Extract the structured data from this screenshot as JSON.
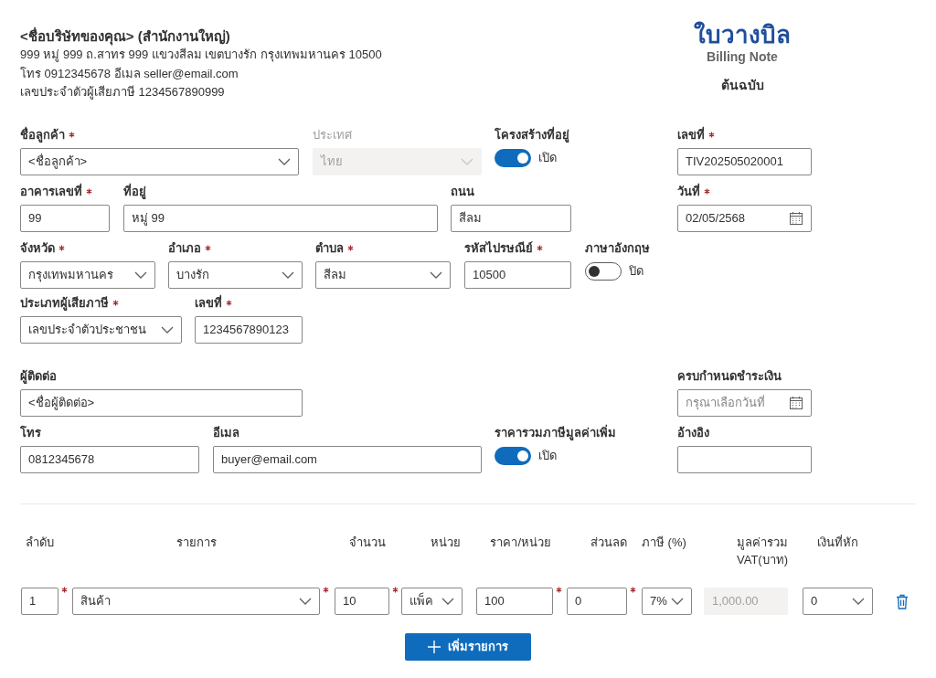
{
  "seller": {
    "name": "<ชื่อบริษัทของคุณ> (สำนักงานใหญ่)",
    "lines": [
      "999 หมู่ 999 ถ.สาทร 999 แขวงสีลม เขตบางรัก กรุงเทพมหานคร 10500",
      "โทร 0912345678 อีเมล seller@email.com",
      "เลขประจำตัวผู้เสียภาษี 1234567890999"
    ]
  },
  "document": {
    "title": "ใบวางบิล",
    "subtitle": "Billing Note",
    "copy": "ต้นฉบับ"
  },
  "form_rows": [
    [
      {
        "kind": "select",
        "label": "ชื่อลูกค้า",
        "required": true,
        "value": "<ชื่อลูกค้า>",
        "disabled": false
      },
      {
        "kind": "select",
        "label": "ประเทศ",
        "required": false,
        "value": "ไทย",
        "disabled": true
      },
      {
        "kind": "toggle",
        "label": "โครงสร้างที่อยู่",
        "on": true,
        "state_label": "เปิด"
      },
      {
        "kind": "text",
        "label": "เลขที่",
        "required": true,
        "value": "TIV202505020001",
        "disabled": false
      }
    ],
    [
      {
        "kind": "text",
        "label": "อาคารเลขที่",
        "required": true,
        "value": "99",
        "disabled": false
      },
      {
        "kind": "text",
        "label": "ที่อยู่",
        "required": false,
        "value": "หมู่ 99",
        "disabled": false
      },
      {
        "kind": "text",
        "label": "ถนน",
        "required": false,
        "value": "สีลม",
        "disabled": false
      },
      {
        "kind": "date",
        "label": "วันที่",
        "required": true,
        "value": "02/05/2568",
        "disabled": false
      }
    ],
    [
      {
        "kind": "select",
        "label": "จังหวัด",
        "required": true,
        "value": "กรุงเทพมหานคร",
        "disabled": false
      },
      {
        "kind": "select",
        "label": "อำเภอ",
        "required": true,
        "value": "บางรัก",
        "disabled": false
      },
      {
        "kind": "select",
        "label": "ตำบล",
        "required": true,
        "value": "สีลม",
        "disabled": false
      },
      {
        "kind": "text",
        "label": "รหัสไปรษณีย์",
        "required": true,
        "value": "10500",
        "disabled": false
      },
      {
        "kind": "toggle",
        "label": "ภาษาอังกฤษ",
        "on": false,
        "state_label": "ปิด"
      }
    ],
    [
      {
        "kind": "select",
        "label": "ประเภทผู้เสียภาษี",
        "required": true,
        "value": "เลขประจำตัวประชาชน",
        "disabled": false
      },
      {
        "kind": "text",
        "label": "เลขที่",
        "required": true,
        "value": "1234567890123",
        "disabled": false
      }
    ],
    [
      {
        "kind": "text",
        "label": "ผู้ติดต่อ",
        "required": false,
        "value": "<ชื่อผู้ติดต่อ>",
        "disabled": false
      },
      {
        "kind": "date",
        "label": "ครบกำหนดชำระเงิน",
        "required": false,
        "placeholder": "กรุณาเลือกวันที่",
        "disabled": false
      }
    ],
    [
      {
        "kind": "text",
        "label": "โทร",
        "required": false,
        "value": "0812345678",
        "disabled": false
      },
      {
        "kind": "text",
        "label": "อีเมล",
        "required": false,
        "value": "buyer@email.com",
        "disabled": false
      },
      {
        "kind": "toggle",
        "label": "ราคารวมภาษีมูลค่าเพิ่ม",
        "on": true,
        "state_label": "เปิด"
      },
      {
        "kind": "text",
        "label": "อ้างอิง",
        "required": false,
        "disabled": false
      }
    ]
  ],
  "items": {
    "columns": [
      {
        "label": "ลำดับ"
      },
      {
        "label": "รายการ"
      },
      {
        "label": "จำนวน"
      },
      {
        "label": "หน่วย"
      },
      {
        "label": "ราคา/หน่วย"
      },
      {
        "label": "ส่วนลด"
      },
      {
        "label": "ภาษี (%)"
      },
      {
        "label": "มูลค่ารวม VAT(บาท)"
      },
      {
        "label": "เงินที่หัก"
      }
    ],
    "rows": [
      {
        "cells": [
          {
            "kind": "text",
            "value": "1",
            "required": true,
            "disabled": false
          },
          {
            "kind": "select",
            "value": "สินค้า",
            "required": true,
            "disabled": false
          },
          {
            "kind": "text",
            "value": "10",
            "required": true,
            "disabled": false
          },
          {
            "kind": "select",
            "value": "แพ็ค",
            "required": false,
            "disabled": false
          },
          {
            "kind": "text",
            "value": "100",
            "required": true,
            "disabled": false
          },
          {
            "kind": "text",
            "value": "0",
            "required": true,
            "disabled": false
          },
          {
            "kind": "select",
            "value": "7%",
            "required": false,
            "disabled": false
          },
          {
            "kind": "text",
            "value": "1,000.00",
            "required": false,
            "disabled": true
          },
          {
            "kind": "select",
            "value": "0",
            "required": false,
            "disabled": false
          }
        ]
      }
    ]
  },
  "add_button": {
    "label": "เพิ่มรายการ"
  }
}
